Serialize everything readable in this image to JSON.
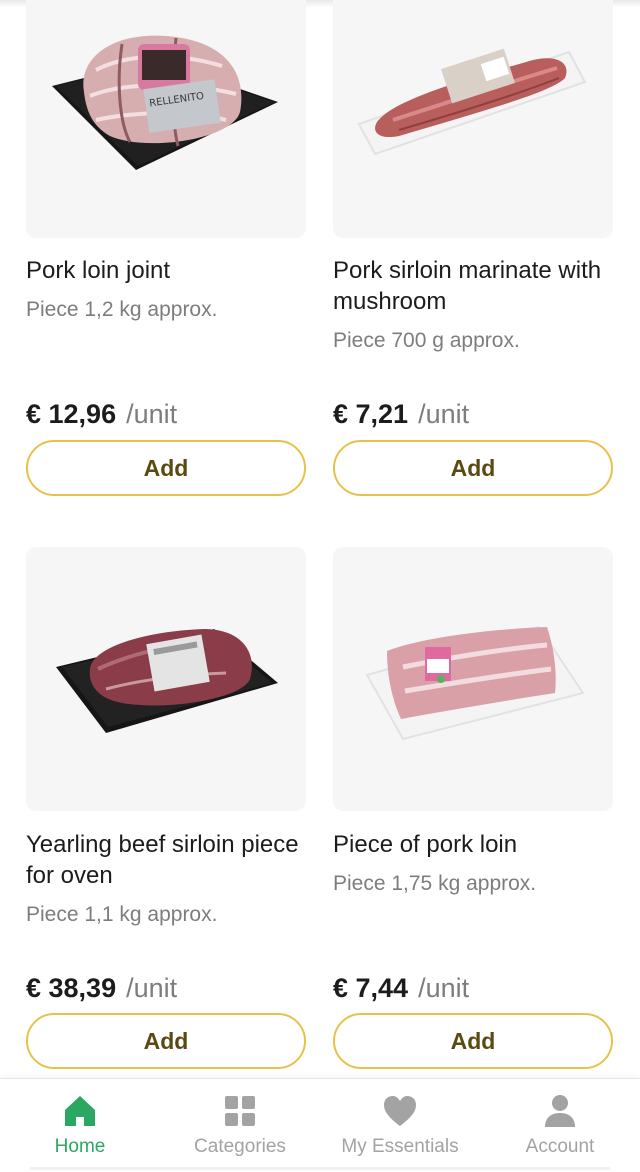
{
  "products": [
    {
      "name": "Pork loin joint",
      "description": "Piece 1,2 kg approx.",
      "price": "€ 12,96",
      "unit": "/unit",
      "add_label": "Add",
      "label_text": "RELLENITO"
    },
    {
      "name": "Pork sirloin marinate with mushroom",
      "description": "Piece 700 g approx.",
      "price": "€ 7,21",
      "unit": "/unit",
      "add_label": "Add"
    },
    {
      "name": "Yearling beef sirloin piece for oven",
      "description": "Piece 1,1 kg approx.",
      "price": "€ 38,39",
      "unit": "/unit",
      "add_label": "Add"
    },
    {
      "name": "Piece of pork loin",
      "description": "Piece 1,75 kg approx.",
      "price": "€ 7,44",
      "unit": "/unit",
      "add_label": "Add"
    }
  ],
  "nav": {
    "items": [
      {
        "label": "Home",
        "icon": "home-icon",
        "active": true
      },
      {
        "label": "Categories",
        "icon": "grid-icon",
        "active": false
      },
      {
        "label": "My Essentials",
        "icon": "heart-icon",
        "active": false
      },
      {
        "label": "Account",
        "icon": "person-icon",
        "active": false
      }
    ],
    "active_color": "#2aa862",
    "inactive_color": "#a3a3a3"
  },
  "colors": {
    "button_border": "#e7c24a",
    "button_text": "#5a4a12",
    "card_background": "#f6f6f6"
  }
}
